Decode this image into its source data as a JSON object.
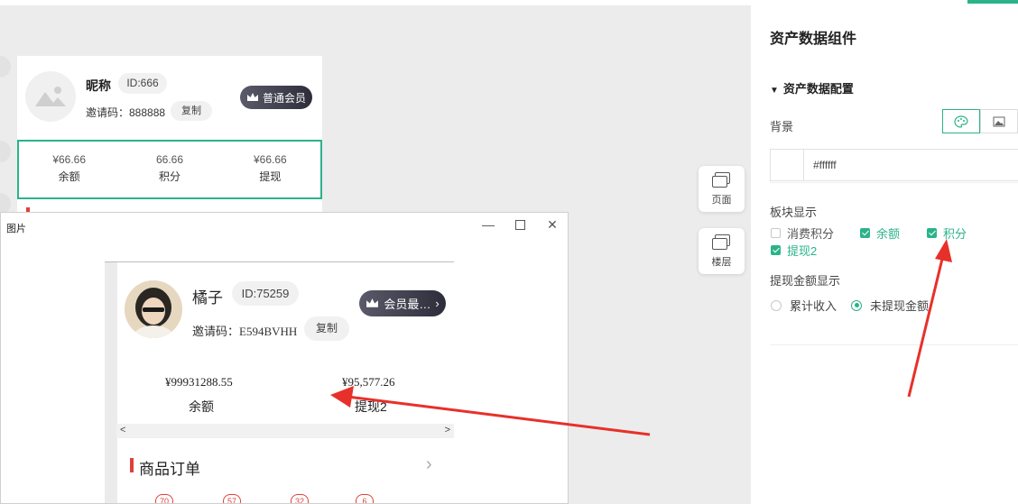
{
  "back_card": {
    "nickname": "昵称",
    "id": "ID:666",
    "invite": "邀请码：888888",
    "copy": "复制",
    "vip": "普通会员",
    "stats": [
      {
        "value": "¥66.66",
        "label": "余额"
      },
      {
        "value": "66.66",
        "label": "积分"
      },
      {
        "value": "¥66.66",
        "label": "提现"
      }
    ]
  },
  "side_buttons": {
    "page": "页面",
    "layer": "楼层"
  },
  "panel": {
    "title": "资产数据组件",
    "section": "资产数据配置",
    "background_label": "背景",
    "color_value": "#ffffff",
    "block_label": "板块显示",
    "checkboxes": [
      {
        "label": "消费积分",
        "checked": false
      },
      {
        "label": "余额",
        "checked": true
      },
      {
        "label": "积分",
        "checked": true
      },
      {
        "label": "提现2",
        "checked": true
      }
    ],
    "withdraw_label": "提现金额显示",
    "radios": [
      {
        "label": "累计收入",
        "checked": false
      },
      {
        "label": "未提现金额",
        "checked": true
      }
    ]
  },
  "window": {
    "title": "图片",
    "profile": {
      "name": "橘子",
      "id": "ID:75259",
      "invite": "邀请码：E594BVHH",
      "copy": "复制",
      "vip": "会员最…"
    },
    "stats": [
      {
        "value": "¥99931288.55",
        "label": "余额"
      },
      {
        "value": "¥95,577.26",
        "label": "提现2"
      }
    ],
    "orders_title": "商品订单",
    "badges": [
      "70",
      "57",
      "32",
      "6"
    ]
  },
  "colors": {
    "accent": "#2bb38a",
    "arrow": "#e8302a",
    "bar": "#e0403a"
  }
}
